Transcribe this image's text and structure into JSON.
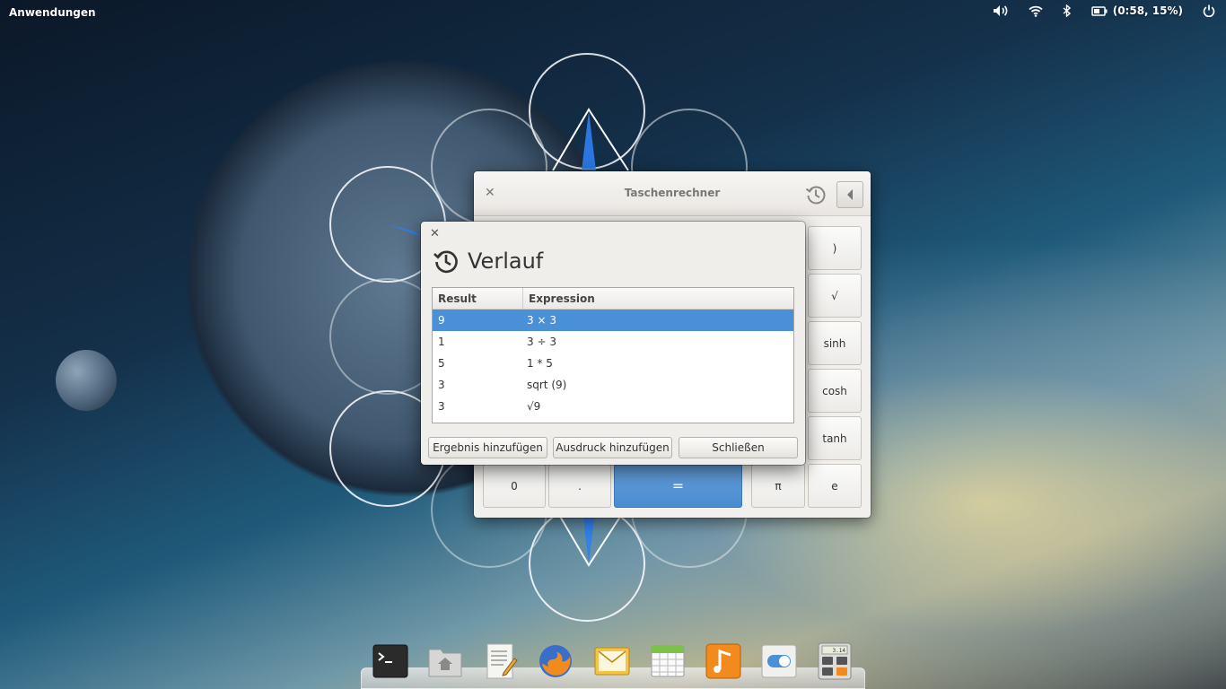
{
  "top_panel": {
    "apps_menu": "Anwendungen",
    "battery": "(0:58, 15%)"
  },
  "calculator": {
    "title": "Taschenrechner",
    "keys_right": [
      ")",
      "√",
      "sinh",
      "cosh",
      "tanh",
      "e"
    ],
    "keys_bottom": {
      "zero": "0",
      "dot": ".",
      "equals": "=",
      "pi": "π"
    }
  },
  "history": {
    "title": "Verlauf",
    "columns": {
      "result": "Result",
      "expression": "Expression"
    },
    "rows": [
      {
        "result": "9",
        "expression": "3 × 3"
      },
      {
        "result": "1",
        "expression": "3 ÷ 3"
      },
      {
        "result": "5",
        "expression": "1 * 5"
      },
      {
        "result": "3",
        "expression": "sqrt (9)"
      },
      {
        "result": "3",
        "expression": "√9"
      }
    ],
    "buttons": {
      "add_result": "Ergebnis hinzufügen",
      "add_expression": "Ausdruck hinzufügen",
      "close": "Schließen"
    }
  },
  "dock": {
    "calculator_display": "3.14"
  },
  "colors": {
    "selection": "#4a90d9",
    "equals_key": "#5a98dc"
  }
}
